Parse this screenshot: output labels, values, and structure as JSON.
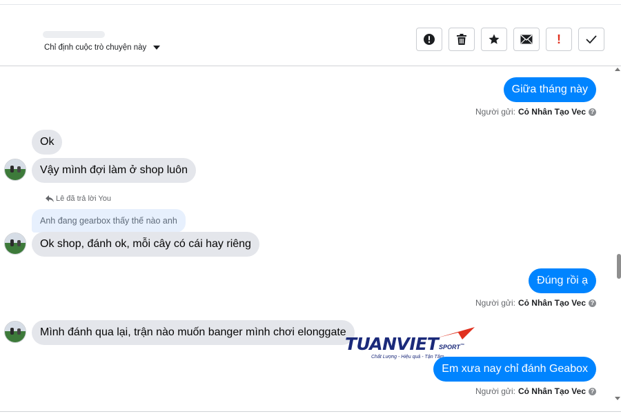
{
  "header": {
    "assign_label": "Chỉ định cuộc trò chuyện này",
    "toolbar": [
      {
        "name": "spam-button",
        "icon": "exclamation-circle-icon"
      },
      {
        "name": "delete-button",
        "icon": "trash-icon"
      },
      {
        "name": "star-button",
        "icon": "star-icon"
      },
      {
        "name": "mark-unread-button",
        "icon": "envelope-icon"
      },
      {
        "name": "important-button",
        "icon": "red-exclamation-icon"
      },
      {
        "name": "done-button",
        "icon": "checkmark-icon"
      }
    ]
  },
  "messages": {
    "m1": "Giữa tháng này",
    "m2": "Ok",
    "m3": "Vậy mình đợi làm ở shop luôn",
    "m4": "Ok shop, đánh ok, mỗi cây có cái hay riêng",
    "m5": "Đúng rồi ạ",
    "m6": "Mình đánh qua lại, trận nào muốn banger mình chơi elonggate",
    "m7": "Em xưa nay chỉ đánh Geabox"
  },
  "reply": {
    "label": "Lê đã trả lời You",
    "quoted": "Anh đang gearbox thấy thế nào anh"
  },
  "sender": {
    "prefix": "Người gửi:",
    "name": "Cỏ Nhân Tạo Vec"
  },
  "watermark": {
    "brand": "TUANVIET",
    "sub": "SPORT",
    "tm": "™",
    "slogan": "Chất Lượng - Hiệu quả - Tận Tâm"
  },
  "colors": {
    "outgoing_bubble": "#0084ff",
    "incoming_bubble": "#e4e6eb",
    "reply_quote": "#e7f0fd",
    "brand_red": "#e0301e",
    "brand_blue": "#1b2a7a"
  }
}
